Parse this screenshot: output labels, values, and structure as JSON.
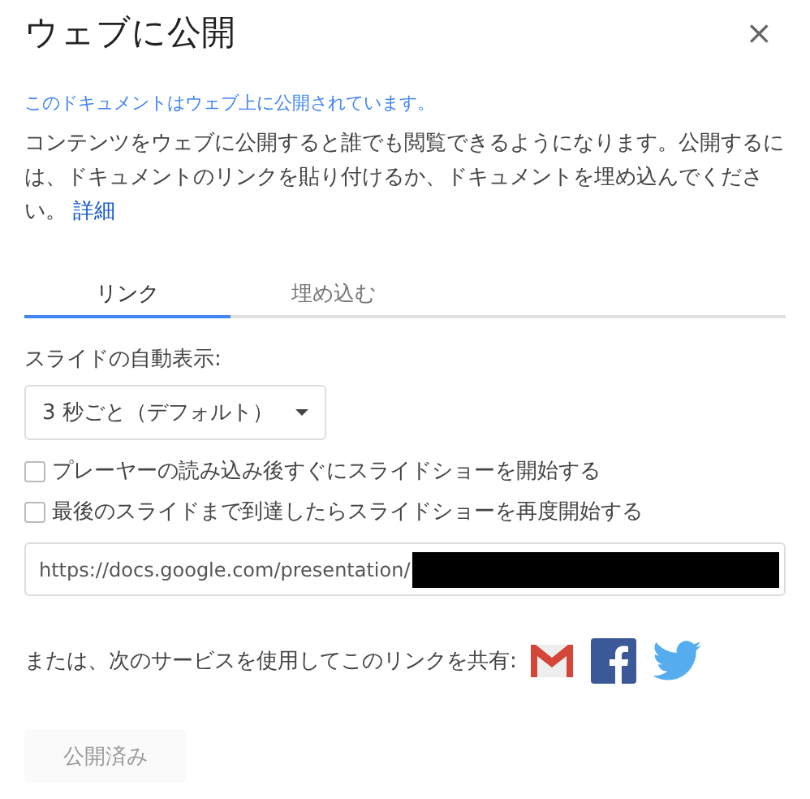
{
  "dialog": {
    "title": "ウェブに公開",
    "close": "×"
  },
  "notice": "このドキュメントはウェブ上に公開されています。",
  "description": {
    "text": "コンテンツをウェブに公開すると誰でも閲覧できるようになります。公開するには、ドキュメントのリンクを貼り付けるか、ドキュメントを埋め込んでください。",
    "link": "詳細"
  },
  "tabs": [
    {
      "label": "リンク",
      "selected": true
    },
    {
      "label": "埋め込む",
      "selected": false
    }
  ],
  "auto_advance": {
    "label": "スライドの自動表示:",
    "value": "3 秒ごと（デフォルト）"
  },
  "options": [
    {
      "label": "プレーヤーの読み込み後すぐにスライドショーを開始する",
      "checked": false
    },
    {
      "label": "最後のスライドまで到達したらスライドショーを再度開始する",
      "checked": false
    }
  ],
  "url_field": {
    "value": "https://docs.google.com/presentation/",
    "redacted": true
  },
  "share": {
    "label": "または、次のサービスを使用してこのリンクを共有:",
    "services": [
      {
        "kind": "gmail"
      },
      {
        "kind": "facebook"
      },
      {
        "kind": "twitter"
      }
    ]
  },
  "publish_button": {
    "label": "公開済み",
    "disabled": true
  }
}
